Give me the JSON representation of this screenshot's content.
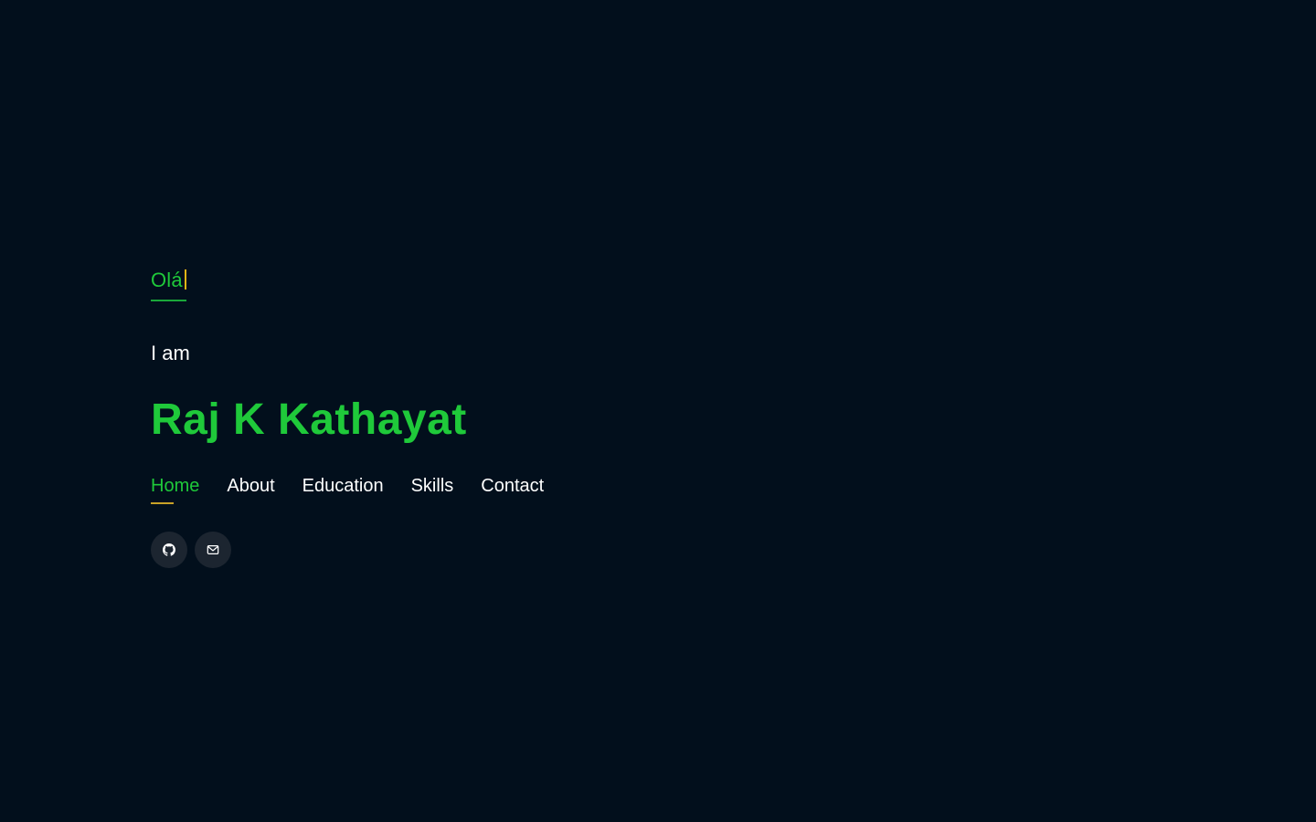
{
  "hero": {
    "greeting": "Olá",
    "intro": "I am",
    "name": "Raj K Kathayat"
  },
  "nav": {
    "items": [
      {
        "label": "Home",
        "active": true
      },
      {
        "label": "About",
        "active": false
      },
      {
        "label": "Education",
        "active": false
      },
      {
        "label": "Skills",
        "active": false
      },
      {
        "label": "Contact",
        "active": false
      }
    ]
  },
  "socials": [
    {
      "icon": "github-icon"
    },
    {
      "icon": "mail-icon"
    }
  ],
  "colors": {
    "background": "#020f1c",
    "accent": "#1fc93a",
    "cursor": "#e2b515",
    "nav_underline": "#c9a227",
    "social_bg": "#1c2530"
  }
}
